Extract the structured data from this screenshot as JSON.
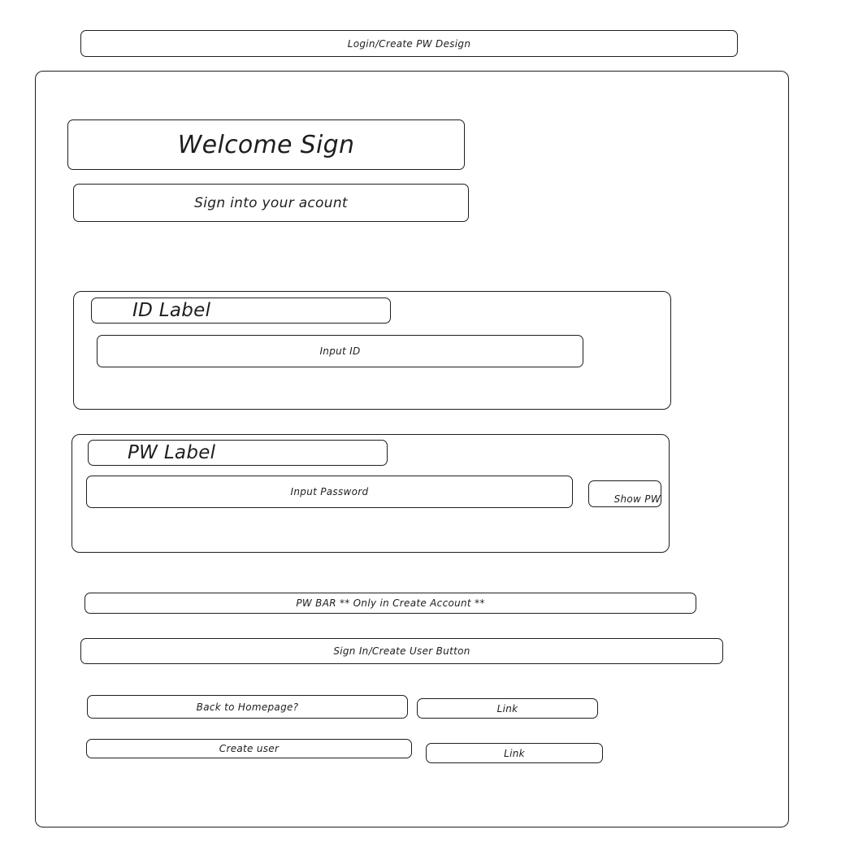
{
  "header": {
    "title": "Login/Create PW Design"
  },
  "welcome": {
    "heading": "Welcome Sign",
    "subheading": "Sign into your acount"
  },
  "id_group": {
    "label": "ID Label",
    "input_text": "Input ID"
  },
  "pw_group": {
    "label": "PW Label",
    "input_text": "Input Password",
    "show_button": "Show PW"
  },
  "pw_bar": {
    "text": "PW BAR ** Only in Create Account **"
  },
  "submit": {
    "label": "Sign In/Create User Button"
  },
  "footer_links": [
    {
      "text": "Back to Homepage?",
      "link_label": "Link"
    },
    {
      "text": "Create user",
      "link_label": "Link"
    }
  ],
  "colors": {
    "stroke": "#1e1e1e",
    "background": "#ffffff"
  }
}
